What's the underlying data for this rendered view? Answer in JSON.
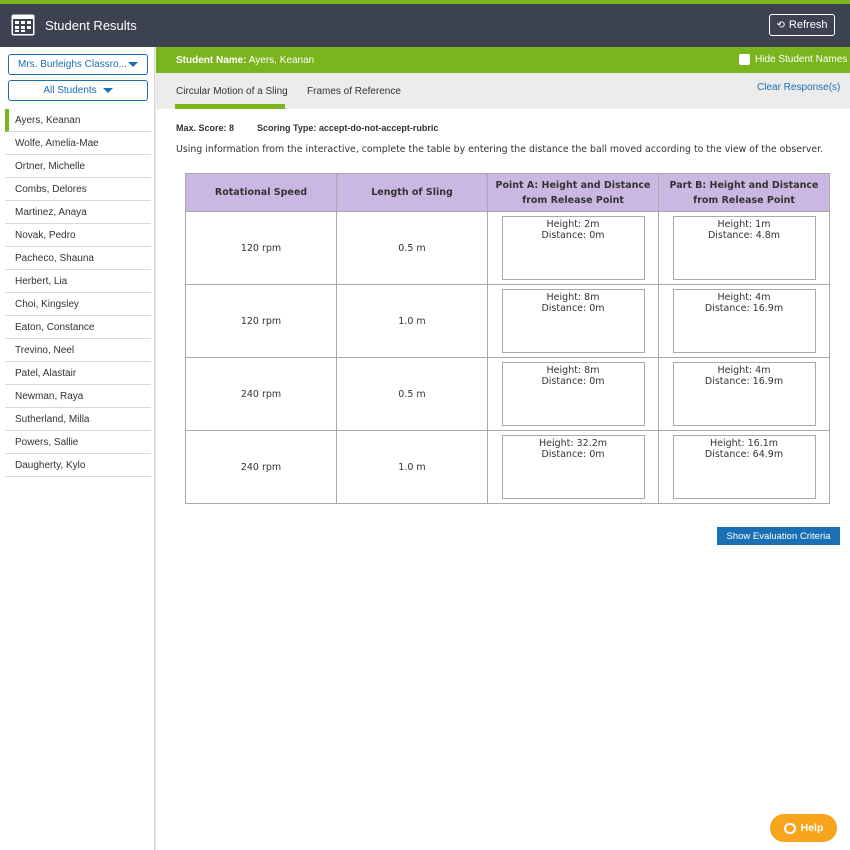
{
  "header": {
    "title": "Student Results",
    "refresh_label": "Refresh"
  },
  "sidebar": {
    "class_select": "Mrs. Burleighs Classro...",
    "students_select": "All Students",
    "students": [
      "Ayers, Keanan",
      "Wolfe, Amelia-Mae",
      "Ortner, Michelle",
      "Combs, Delores",
      "Martinez, Anaya",
      "Novak, Pedro",
      "Pacheco, Shauna",
      "Herbert, Lia",
      "Choi, Kingsley",
      "Eaton, Constance",
      "Trevino, Neel",
      "Patel, Alastair",
      "Newman, Raya",
      "Sutherland, Milla",
      "Powers, Sallie",
      "Daugherty, Kylo"
    ],
    "active_index": 0
  },
  "student_bar": {
    "name_label": "Student Name:",
    "name_value": "Ayers, Keanan",
    "hide_names_label": "Hide Student Names"
  },
  "tabs": {
    "items": [
      "Circular Motion of a Sling",
      "Frames of Reference"
    ],
    "active_index": 0,
    "clear_label": "Clear Response(s)"
  },
  "question": {
    "max_score_label": "Max. Score: 8",
    "scoring_type_label": "Scoring Type: accept-do-not-accept-rubric",
    "prompt": "Using information from the interactive, complete the table by entering the distance the ball moved according to the view of the observer."
  },
  "table": {
    "headers": [
      "Rotational Speed",
      "Length of Sling",
      "Point A: Height and Distance from Release Point",
      "Part B: Height and Distance from Release Point"
    ],
    "rows": [
      {
        "speed": "120 rpm",
        "length": "0.5 m",
        "a_height": "Height:  2m",
        "a_distance": "Distance: 0m",
        "b_height": "Height:  1m",
        "b_distance": "Distance: 4.8m"
      },
      {
        "speed": "120 rpm",
        "length": "1.0 m",
        "a_height": "Height:  8m",
        "a_distance": "Distance: 0m",
        "b_height": "Height:  4m",
        "b_distance": "Distance: 16.9m"
      },
      {
        "speed": "240 rpm",
        "length": "0.5 m",
        "a_height": "Height:  8m",
        "a_distance": "Distance: 0m",
        "b_height": "Height:  4m",
        "b_distance": "Distance: 16.9m"
      },
      {
        "speed": "240 rpm",
        "length": "1.0 m",
        "a_height": "Height: 32.2m",
        "a_distance": "Distance: 0m",
        "b_height": "Height: 16.1m",
        "b_distance": "Distance: 64.9m"
      }
    ]
  },
  "buttons": {
    "eval_label": "Show Evaluation Criteria",
    "help_label": "Help"
  },
  "colors": {
    "accent_green": "#7ab51d",
    "header_dark": "#3d4250",
    "link_blue": "#1a6fb5",
    "table_header": "#cbb8e2",
    "help_orange": "#f7a51d"
  }
}
